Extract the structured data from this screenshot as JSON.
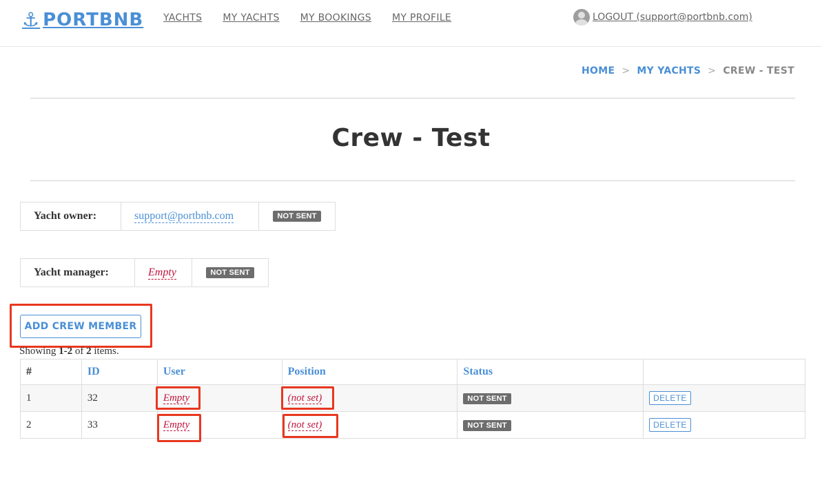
{
  "header": {
    "logo_icon": "anchor-icon",
    "logo_text": "PORTBNB",
    "nav": [
      {
        "label": "YACHTS"
      },
      {
        "label": "MY YACHTS"
      },
      {
        "label": "MY BOOKINGS"
      },
      {
        "label": "MY PROFILE"
      }
    ],
    "logout_label": "LOGOUT (support@portbnb.com)"
  },
  "breadcrumb": {
    "home": "HOME",
    "my_yachts": "MY YACHTS",
    "current": "CREW - TEST",
    "separator": ">"
  },
  "page_title": "Crew - Test",
  "owner": {
    "label": "Yacht owner:",
    "value": "support@portbnb.com",
    "status": "NOT SENT"
  },
  "manager": {
    "label": "Yacht manager:",
    "value": "Empty",
    "status": "NOT SENT"
  },
  "add_button": "ADD CREW MEMBER",
  "summary": {
    "prefix": "Showing ",
    "range": "1-2",
    "middle": " of ",
    "total": "2",
    "suffix": " items."
  },
  "table": {
    "headers": {
      "num": "#",
      "id": "ID",
      "user": "User",
      "position": "Position",
      "status": "Status",
      "actions": ""
    },
    "rows": [
      {
        "num": "1",
        "id": "32",
        "user": "Empty",
        "position": "(not set)",
        "status": "NOT SENT",
        "action": "DELETE"
      },
      {
        "num": "2",
        "id": "33",
        "user": "Empty",
        "position": "(not set)",
        "status": "NOT SENT",
        "action": "DELETE"
      }
    ]
  },
  "colors": {
    "accent": "#4a8fd6",
    "empty": "#c0143c",
    "badge": "#6d6d6d",
    "highlight": "#e8371f"
  }
}
